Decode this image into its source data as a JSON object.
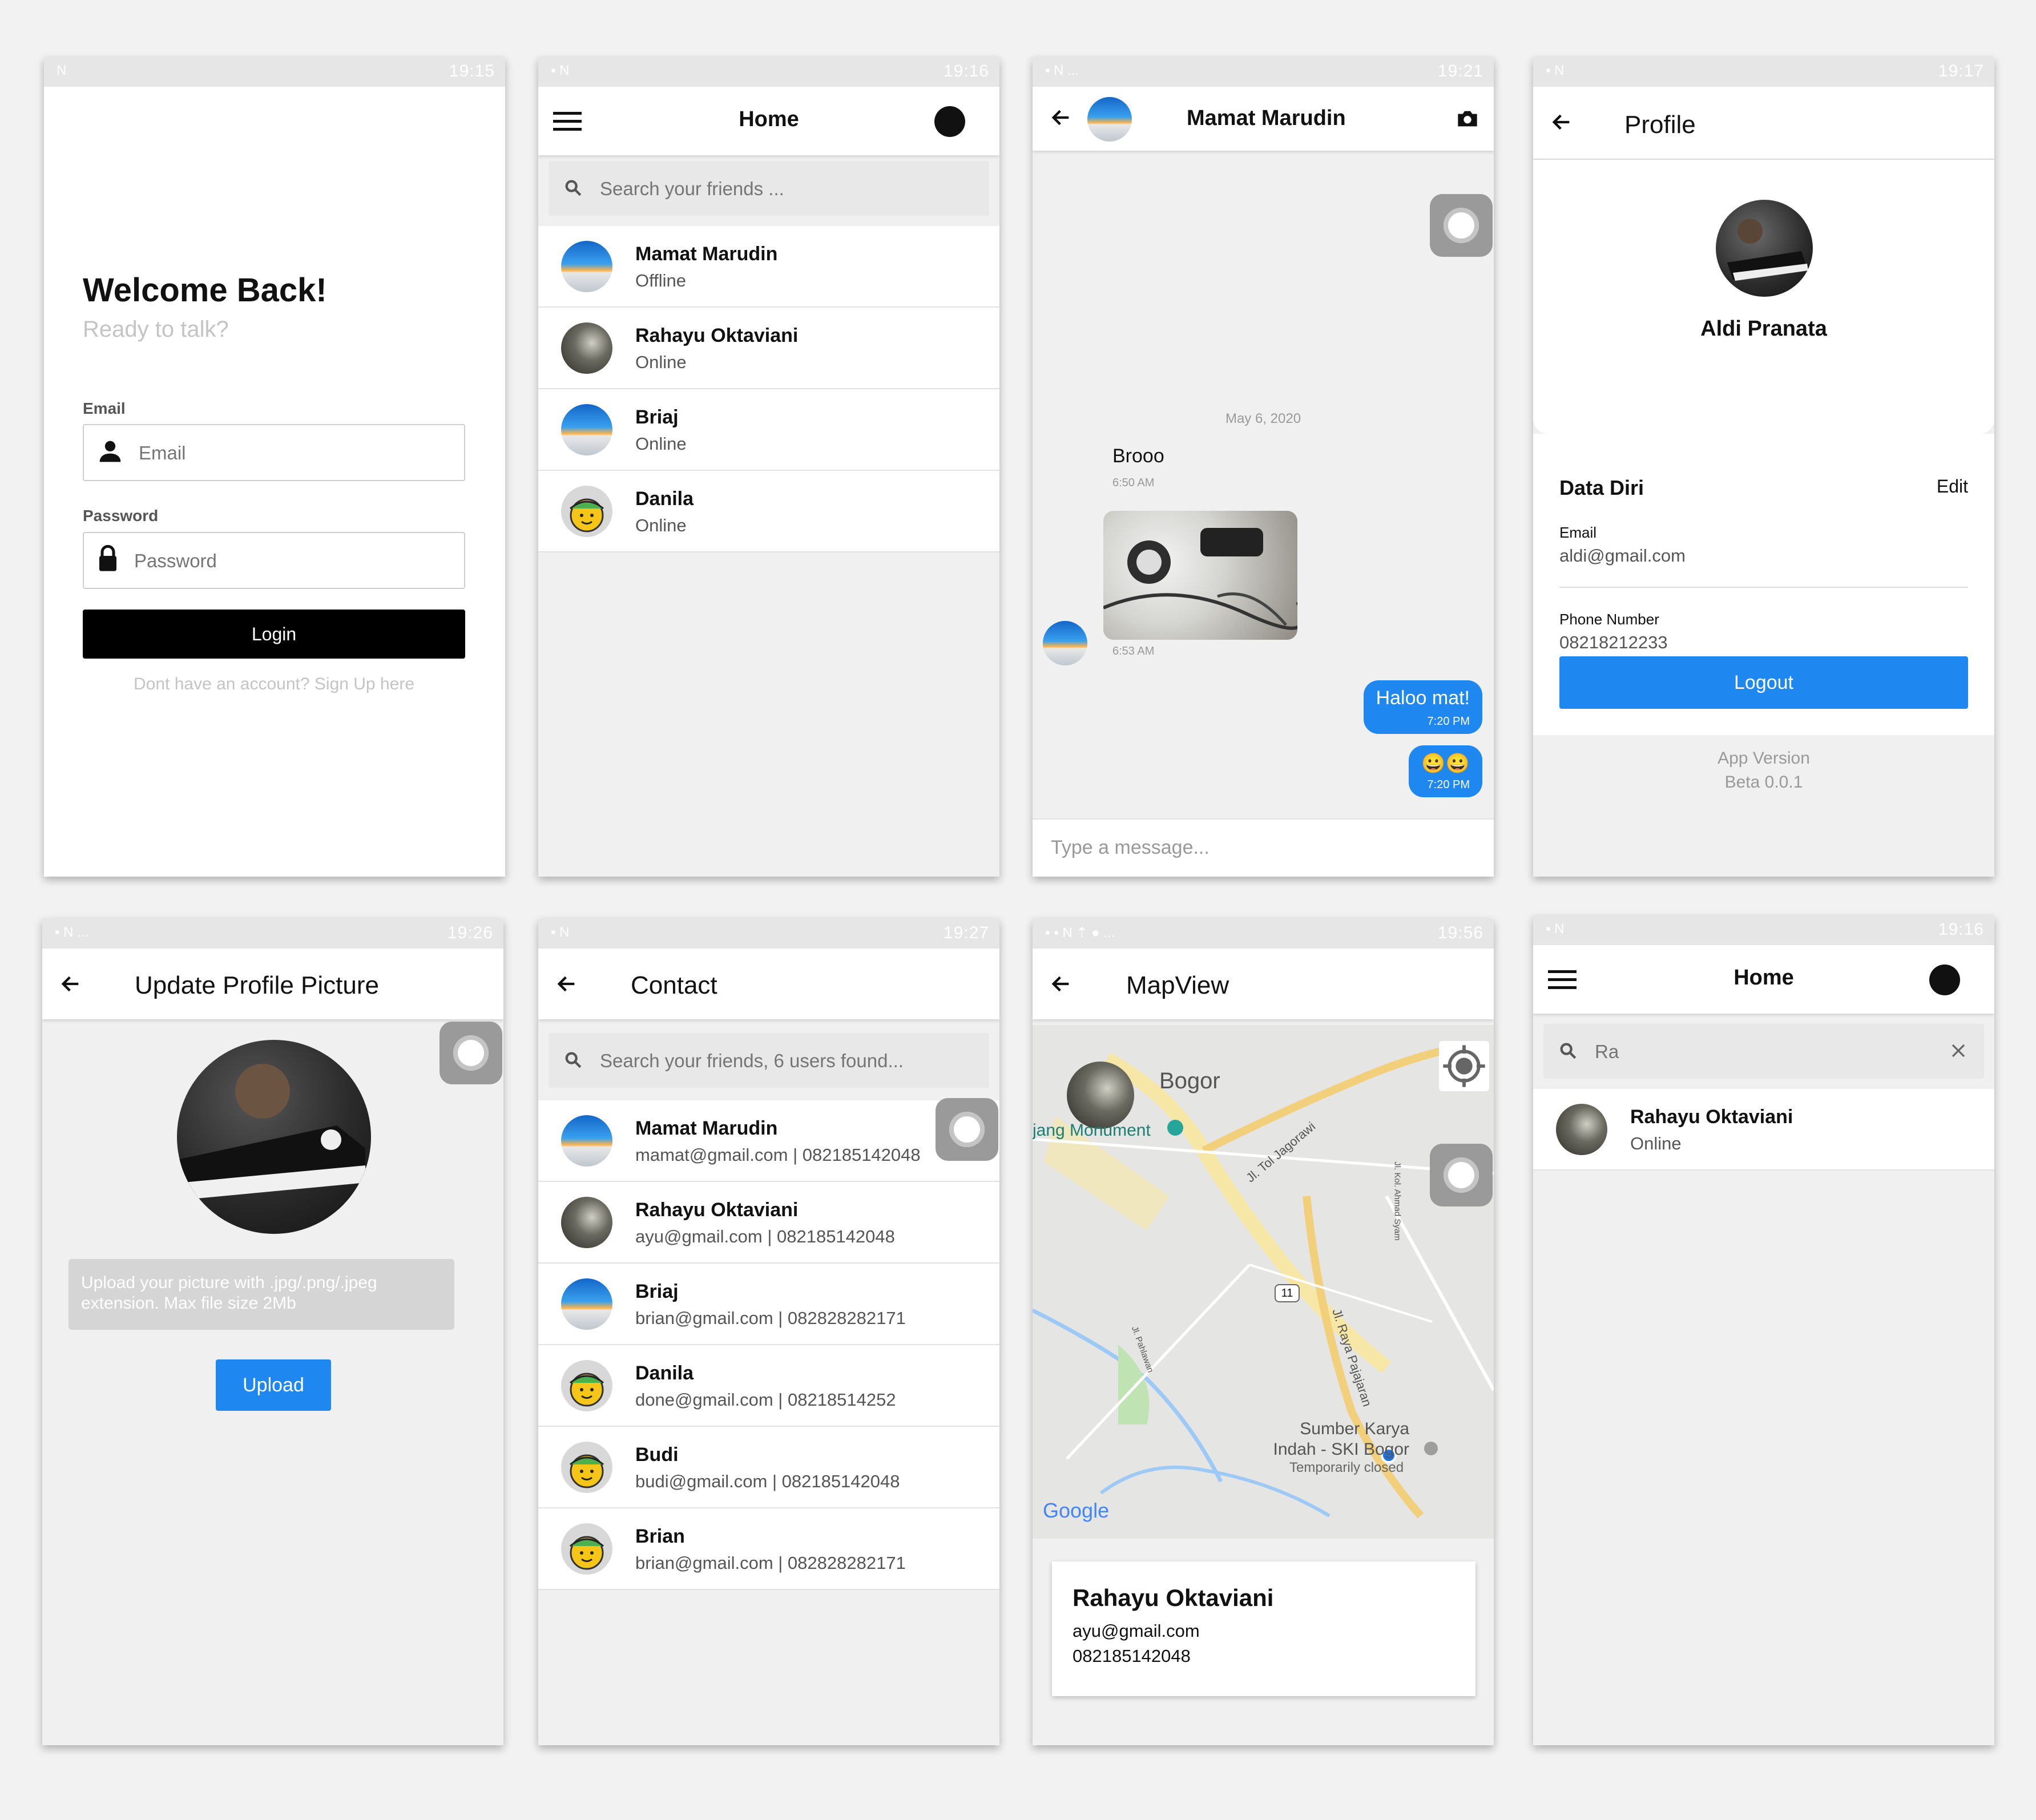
{
  "icons": {
    "back": "arrow-left-icon",
    "menu": "hamburger-menu-icon",
    "profile": "account-circle-icon",
    "search": "search-icon",
    "camera": "camera-icon",
    "clear": "close-icon",
    "locate": "my-location-icon",
    "user": "person-icon",
    "lock": "lock-icon"
  },
  "login": {
    "time": "19:15",
    "title": "Welcome Back!",
    "subtitle": "Ready to talk?",
    "email_label": "Email",
    "email_placeholder": "Email",
    "password_label": "Password",
    "password_placeholder": "Password",
    "login_button": "Login",
    "signup_text": "Dont have an account? Sign Up here"
  },
  "home": {
    "time": "19:16",
    "title": "Home",
    "search_placeholder": "Search your friends ...",
    "friends": [
      {
        "name": "Mamat Marudin",
        "status": "Offline"
      },
      {
        "name": "Rahayu Oktaviani",
        "status": "Online"
      },
      {
        "name": "Briaj",
        "status": "Online"
      },
      {
        "name": "Danila",
        "status": "Online"
      }
    ]
  },
  "chat": {
    "time": "19:21",
    "title": "Mamat Marudin",
    "date": "May 6, 2020",
    "messages": [
      {
        "text": "Brooo",
        "time": "6:50 AM"
      },
      {
        "image_time": "6:53 AM"
      },
      {
        "text": "Haloo mat!",
        "time": "7:20 PM"
      },
      {
        "text": "😀😀",
        "time": "7:20 PM"
      }
    ],
    "input_placeholder": "Type a message..."
  },
  "profile": {
    "time": "19:17",
    "title": "Profile",
    "name": "Aldi Pranata",
    "section_title": "Data Diri",
    "edit_label": "Edit",
    "email_label": "Email",
    "email": "aldi@gmail.com",
    "phone_label": "Phone Number",
    "phone": "08218212233",
    "logout_button": "Logout",
    "version_label": "App Version",
    "version": "Beta 0.0.1"
  },
  "update_picture": {
    "time": "19:26",
    "title": "Update Profile Picture",
    "hint": "Upload your picture with .jpg/.png/.jpeg extension. Max file size 2Mb",
    "upload_button": "Upload"
  },
  "contact": {
    "time": "19:27",
    "title": "Contact",
    "search_placeholder": "Search your friends, 6 users found...",
    "contacts": [
      {
        "name": "Mamat Marudin",
        "detail": "mamat@gmail.com | 082185142048"
      },
      {
        "name": "Rahayu Oktaviani",
        "detail": "ayu@gmail.com | 082185142048"
      },
      {
        "name": "Briaj",
        "detail": "brian@gmail.com | 082828282171"
      },
      {
        "name": "Danila",
        "detail": "done@gmail.com | 08218514252"
      },
      {
        "name": "Budi",
        "detail": "budi@gmail.com | 082185142048"
      },
      {
        "name": "Brian",
        "detail": "brian@gmail.com | 082828282171"
      }
    ]
  },
  "map": {
    "time": "19:56",
    "title": "MapView",
    "labels": {
      "city": "Bogor",
      "monument": "jang Monument",
      "road1": "Jl. Tol Jagorawi",
      "road2": "Jl. Raya Pajajaran",
      "road3": "Jl. Kol. Ahmad Syam",
      "road4": "Jl. Pahlawan",
      "route": "11",
      "poi": "Sumber Karya Indah - SKI Bogor",
      "poi_status": "Temporarily closed",
      "logo": "Google"
    },
    "card": {
      "name": "Rahayu Oktaviani",
      "email": "ayu@gmail.com",
      "phone": "082185142048"
    }
  },
  "home_search": {
    "time": "19:16",
    "title": "Home",
    "query": "Ra",
    "result": {
      "name": "Rahayu Oktaviani",
      "status": "Online"
    }
  }
}
